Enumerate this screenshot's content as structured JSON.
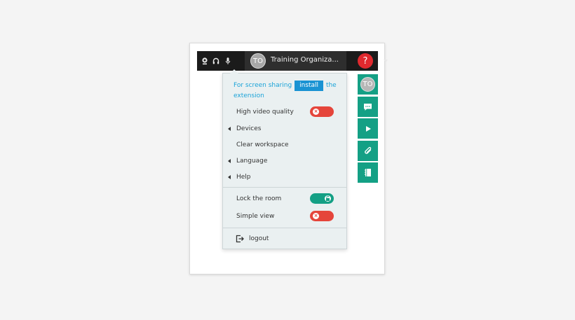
{
  "header": {
    "user_initials": "TO",
    "user_name": "Training Organiza...",
    "help_label": "?"
  },
  "icons": [
    "webcam-icon",
    "headphones-icon",
    "microphone-icon",
    "chevron-down-icon",
    "chat-icon",
    "play-icon",
    "paperclip-icon",
    "notebook-icon",
    "unlock-icon",
    "logout-icon"
  ],
  "side_panel": {
    "avatar_initials": "TO"
  },
  "menu": {
    "screen_share": {
      "prefix": "For screen sharing",
      "button_label": "install",
      "suffix": "the extension"
    },
    "items": [
      {
        "label": "High video quality",
        "toggle": "off"
      },
      {
        "label": "Devices",
        "submenu": true
      },
      {
        "label": "Clear workspace"
      },
      {
        "label": "Language",
        "submenu": true
      },
      {
        "label": "Help",
        "submenu": true
      }
    ],
    "room_items": [
      {
        "label": "Lock the room",
        "toggle": "on"
      },
      {
        "label": "Simple view",
        "toggle": "off"
      }
    ],
    "logout_label": "logout"
  },
  "colors": {
    "topbar": "#1b1b1b",
    "accent_teal": "#14a085",
    "danger_red": "#e5453b",
    "help_red": "#e0292e",
    "link_blue": "#1ba3d8",
    "install_blue": "#1a93d3",
    "menu_bg": "#eaf0f1"
  }
}
